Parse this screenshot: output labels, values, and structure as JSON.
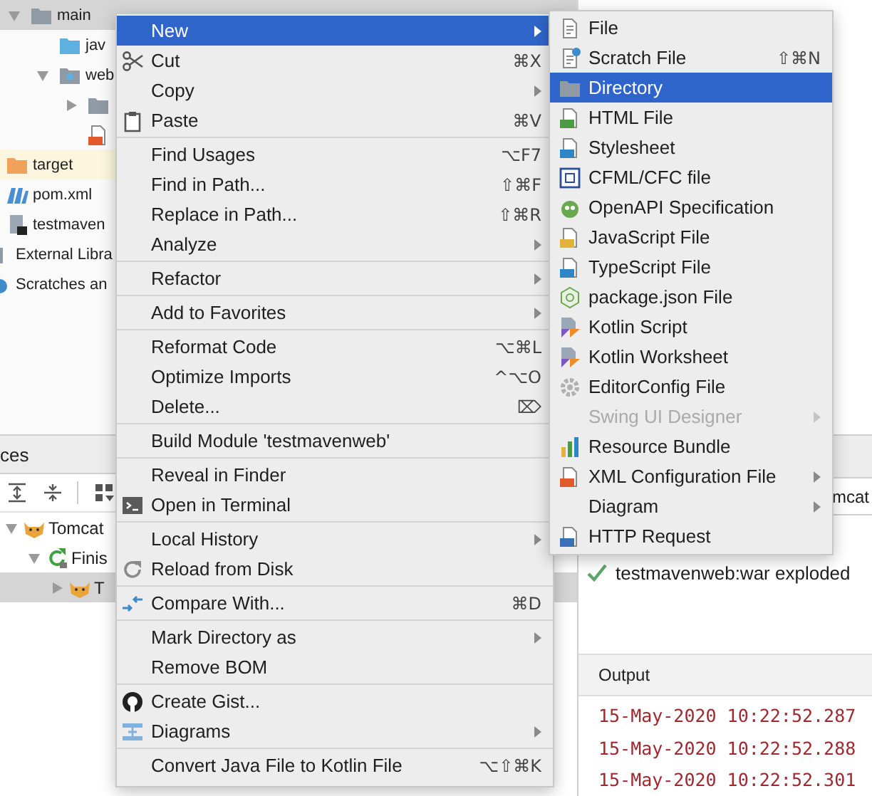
{
  "project_tree": {
    "items": [
      {
        "label": "main",
        "kind": "folder",
        "selected": true,
        "expanded": true,
        "children": [
          {
            "label": "jav",
            "kind": "source-folder",
            "selected": false
          },
          {
            "label": "web",
            "kind": "web-folder",
            "selected": false,
            "expanded": true,
            "children": [
              {
                "kind": "folder",
                "selected": false,
                "expanded": false
              },
              {
                "kind": "jsp",
                "selected": false
              }
            ]
          }
        ]
      },
      {
        "label": "target",
        "kind": "excluded-folder",
        "selected": false
      },
      {
        "label": "pom.xml",
        "kind": "maven",
        "selected": false
      },
      {
        "label": "testmaven",
        "kind": "iml",
        "selected": false
      },
      {
        "label": "External Libra",
        "kind": "library",
        "selected": false
      },
      {
        "label": "Scratches an",
        "kind": "scratches",
        "selected": false
      }
    ]
  },
  "services": {
    "title": "ces",
    "items": [
      {
        "label": "Tomcat",
        "kind": "tomcat",
        "selected": false,
        "expanded": true,
        "children": [
          {
            "label": "Finis",
            "kind": "restart",
            "selected": false,
            "expanded": true,
            "children": [
              {
                "label": "T",
                "kind": "tomcat",
                "selected": true,
                "expanded": false
              }
            ]
          }
        ]
      }
    ]
  },
  "run_panel": {
    "tab": "mcat",
    "deployment": {
      "label": "testmavenweb:war exploded",
      "deployed": true
    },
    "output_title": "Output",
    "log_lines": [
      "15-May-2020 10:22:52.287",
      "15-May-2020 10:22:52.288",
      "15-May-2020 10:22:52.301"
    ]
  },
  "context_menu": {
    "sections": [
      {
        "items": [
          {
            "label": "New",
            "selected": true,
            "submenu": true
          },
          {
            "label": "Cut",
            "shortcut": "⌘X",
            "selected": false
          },
          {
            "label": "Copy",
            "selected": false,
            "submenu": true
          },
          {
            "label": "Paste",
            "shortcut": "⌘V",
            "selected": false
          }
        ]
      },
      {
        "items": [
          {
            "label": "Find Usages",
            "shortcut": "⌥F7",
            "selected": false
          },
          {
            "label": "Find in Path...",
            "shortcut": "⇧⌘F",
            "selected": false
          },
          {
            "label": "Replace in Path...",
            "shortcut": "⇧⌘R",
            "selected": false
          },
          {
            "label": "Analyze",
            "selected": false,
            "submenu": true
          }
        ]
      },
      {
        "items": [
          {
            "label": "Refactor",
            "selected": false,
            "submenu": true
          }
        ]
      },
      {
        "items": [
          {
            "label": "Add to Favorites",
            "selected": false,
            "submenu": true
          }
        ]
      },
      {
        "items": [
          {
            "label": "Reformat Code",
            "shortcut": "⌥⌘L",
            "selected": false
          },
          {
            "label": "Optimize Imports",
            "shortcut": "^⌥O",
            "selected": false
          },
          {
            "label": "Delete...",
            "shortcut": "⌦",
            "selected": false
          }
        ]
      },
      {
        "items": [
          {
            "label": "Build Module 'testmavenweb'",
            "selected": false
          }
        ]
      },
      {
        "items": [
          {
            "label": "Reveal in Finder",
            "selected": false
          },
          {
            "label": "Open in Terminal",
            "selected": false
          }
        ]
      },
      {
        "items": [
          {
            "label": "Local History",
            "selected": false,
            "submenu": true
          },
          {
            "label": "Reload from Disk",
            "selected": false
          }
        ]
      },
      {
        "items": [
          {
            "label": "Compare With...",
            "shortcut": "⌘D",
            "selected": false
          }
        ]
      },
      {
        "items": [
          {
            "label": "Mark Directory as",
            "selected": false,
            "submenu": true
          },
          {
            "label": "Remove BOM",
            "selected": false
          }
        ]
      },
      {
        "items": [
          {
            "label": "Create Gist...",
            "selected": false
          },
          {
            "label": "Diagrams",
            "selected": false,
            "submenu": true
          }
        ]
      },
      {
        "items": [
          {
            "label": "Convert Java File to Kotlin File",
            "shortcut": "⌥⇧⌘K",
            "selected": false
          }
        ]
      }
    ]
  },
  "new_submenu": {
    "items": [
      {
        "label": "File",
        "selected": false,
        "disabled": false
      },
      {
        "label": "Scratch File",
        "shortcut": "⇧⌘N",
        "selected": false,
        "disabled": false
      },
      {
        "label": "Directory",
        "selected": true,
        "disabled": false
      },
      {
        "label": "HTML File",
        "selected": false,
        "disabled": false
      },
      {
        "label": "Stylesheet",
        "selected": false,
        "disabled": false
      },
      {
        "label": "CFML/CFC file",
        "selected": false,
        "disabled": false
      },
      {
        "label": "OpenAPI Specification",
        "selected": false,
        "disabled": false
      },
      {
        "label": "JavaScript File",
        "selected": false,
        "disabled": false
      },
      {
        "label": "TypeScript File",
        "selected": false,
        "disabled": false
      },
      {
        "label": "package.json File",
        "selected": false,
        "disabled": false
      },
      {
        "label": "Kotlin Script",
        "selected": false,
        "disabled": false
      },
      {
        "label": "Kotlin Worksheet",
        "selected": false,
        "disabled": false
      },
      {
        "label": "EditorConfig File",
        "selected": false,
        "disabled": false
      },
      {
        "label": "Swing UI Designer",
        "selected": false,
        "disabled": true,
        "submenu": true
      },
      {
        "label": "Resource Bundle",
        "selected": false,
        "disabled": false
      },
      {
        "label": "XML Configuration File",
        "selected": false,
        "disabled": false,
        "submenu": true
      },
      {
        "label": "Diagram",
        "selected": false,
        "disabled": false,
        "submenu": true
      },
      {
        "label": "HTTP Request",
        "selected": false,
        "disabled": false
      }
    ]
  }
}
